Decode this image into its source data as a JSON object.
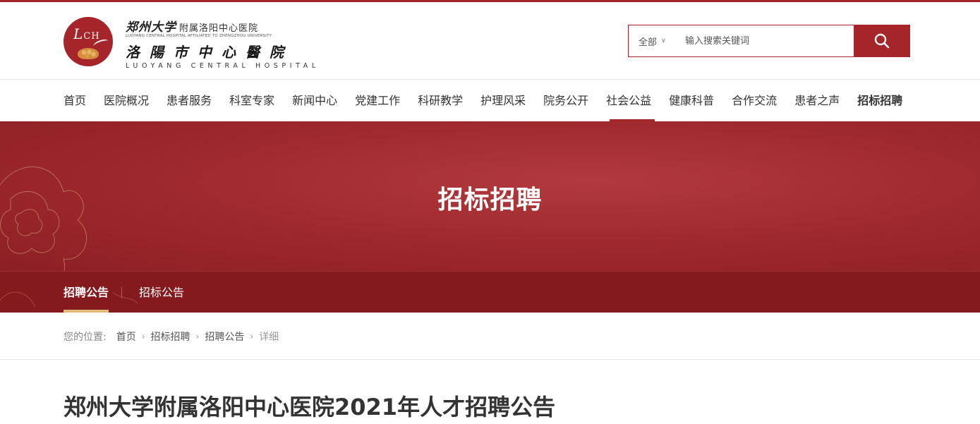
{
  "colors": {
    "brand": "#a5252b",
    "sub_bar": "#851a1e",
    "gold": "#e1bb76"
  },
  "logo": {
    "mark_text": "LCH",
    "line1_cal": "郑州大学",
    "line1_sub": "附属洛阳中心医院",
    "line2_en": "LUOYANG CENTRAL HOSPITAL AFFILIATED TO ZHENGZHOU UNIVERSITY",
    "line3_cal": "洛陽市中心醫院",
    "line4_en": "LUOYANG CENTRAL HOSPITAL"
  },
  "search": {
    "scope": "全部",
    "placeholder": "输入搜索关键词",
    "icon": "search-icon"
  },
  "nav": [
    {
      "label": "首页"
    },
    {
      "label": "医院概况"
    },
    {
      "label": "患者服务"
    },
    {
      "label": "科室专家"
    },
    {
      "label": "新闻中心"
    },
    {
      "label": "党建工作"
    },
    {
      "label": "科研教学"
    },
    {
      "label": "护理风采"
    },
    {
      "label": "院务公开"
    },
    {
      "label": "社会公益",
      "active": true
    },
    {
      "label": "健康科普"
    },
    {
      "label": "合作交流"
    },
    {
      "label": "患者之声"
    },
    {
      "label": "招标招聘",
      "bold": true
    }
  ],
  "banner": {
    "title": "招标招聘"
  },
  "subtabs": [
    {
      "label": "招聘公告",
      "active": true
    },
    {
      "label": "招标公告"
    }
  ],
  "breadcrumb": {
    "label": "您的位置:",
    "items": [
      "首页",
      "招标招聘",
      "招聘公告"
    ],
    "current": "详细"
  },
  "article": {
    "title": "郑州大学附属洛阳中心医院2021年人才招聘公告"
  }
}
